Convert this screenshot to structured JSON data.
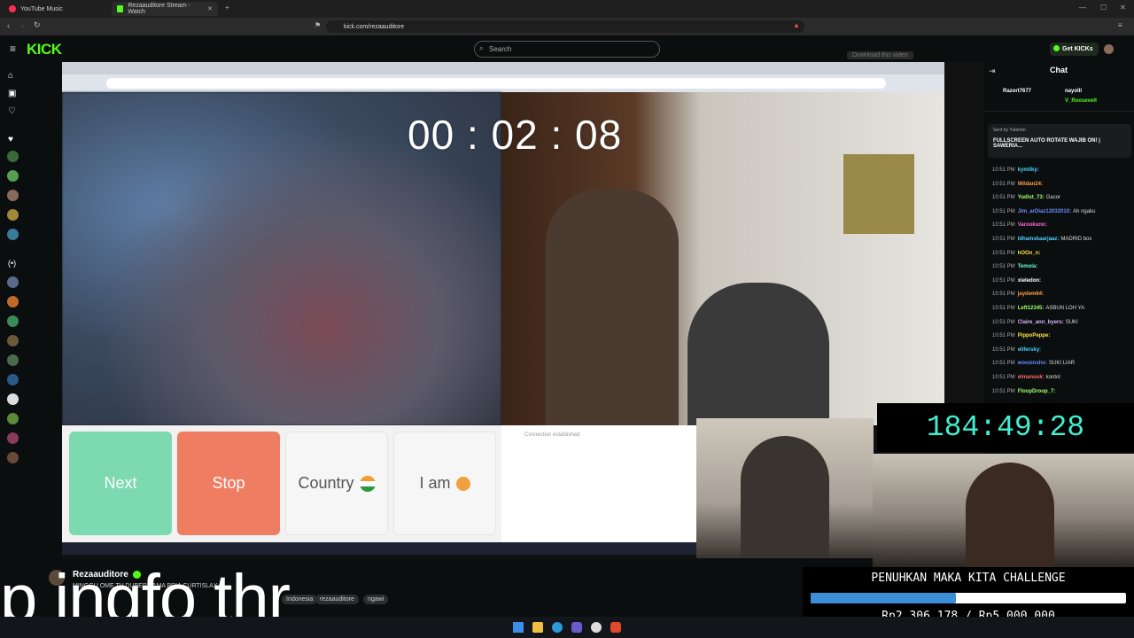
{
  "browser": {
    "tabs": [
      {
        "label": "YouTube Music",
        "icon_color": "#ff2d55",
        "active": false
      },
      {
        "label": "Rezaauditore Stream - Watch",
        "icon_color": "#53fc18",
        "active": true
      }
    ],
    "url": "kick.com/rezaauditore"
  },
  "kick": {
    "logo": "KICK",
    "search_placeholder": "Search",
    "get_kicks": "Get KICKs",
    "download_hint": "Download this video"
  },
  "omegle": {
    "timer": "00 : 02 : 08",
    "buttons": {
      "next": "Next",
      "stop": "Stop",
      "country": "Country",
      "iam": "I am"
    },
    "chat_status": "Connection established"
  },
  "overlay": {
    "counter": "184:49:28",
    "caption": "p ingfo thr"
  },
  "challenge": {
    "title": "PENUHKAN MAKA KITA CHALLENGE",
    "amount": "Rp2.306.178 / Rp5.000.000",
    "progress": 0.461
  },
  "streamer": {
    "name": "Rezaauditore",
    "stream_title": "MINGGU OME TV DUBERMAMA PRIA CURTISLAX",
    "tags": [
      "Indonesia",
      "rezaauditore",
      "ngawi"
    ]
  },
  "chat": {
    "header": "Chat",
    "top_users": [
      "Razort7677",
      "nayolll",
      "V_Roosevelt"
    ],
    "pinned": "FULLSCREEN AUTO ROTATE WAJIB ON! | SAWERIA...",
    "pinned_by": "Sent by Yuterion",
    "messages": [
      {
        "time": "10:51 PM",
        "user": "kymilky:",
        "text": "",
        "color": "#4fd1ff"
      },
      {
        "time": "10:51 PM",
        "user": "Wildan24:",
        "text": "",
        "color": "#ff9f4a"
      },
      {
        "time": "10:51 PM",
        "user": "Yudist_73:",
        "text": "Gacor",
        "color": "#a0ff6a"
      },
      {
        "time": "10:51 PM",
        "user": "Jim_arDiaz12032010:",
        "text": "Ah ngaku",
        "color": "#6a8cff"
      },
      {
        "time": "10:51 PM",
        "user": "Varookuno:",
        "text": "",
        "color": "#ff6ad5"
      },
      {
        "time": "10:51 PM",
        "user": "Idhamskaarjaaz:",
        "text": "MADRID bos",
        "color": "#4fd1ff"
      },
      {
        "time": "10:51 PM",
        "user": "hOOn_n:",
        "text": "",
        "color": "#ffe14a"
      },
      {
        "time": "10:51 PM",
        "user": "Temola:",
        "text": "",
        "color": "#6affc8"
      },
      {
        "time": "10:51 PM",
        "user": "xieledon:",
        "text": "",
        "color": "#ffffff"
      },
      {
        "time": "10:51 PM",
        "user": "jaydem64:",
        "text": "",
        "color": "#ff9f4a"
      },
      {
        "time": "10:51 PM",
        "user": "Left12345:",
        "text": "ASBUN LOH YA",
        "color": "#a0ff6a"
      },
      {
        "time": "10:51 PM",
        "user": "Claire_ann_byers:",
        "text": "SUKI",
        "color": "#d9b3ff"
      },
      {
        "time": "10:51 PM",
        "user": "PippoPeppe:",
        "text": "",
        "color": "#ffe14a"
      },
      {
        "time": "10:51 PM",
        "user": "elifersky:",
        "text": "",
        "color": "#4fd1ff"
      },
      {
        "time": "10:51 PM",
        "user": "woosinsho:",
        "text": "SUKI LIAR",
        "color": "#6a8cff"
      },
      {
        "time": "10:51 PM",
        "user": "elmanuuk:",
        "text": "kontol",
        "color": "#ff6a6a"
      },
      {
        "time": "10:51 PM",
        "user": "FloopDroop_7:",
        "text": "",
        "color": "#a0ff6a"
      }
    ]
  },
  "colors": {
    "kick_green": "#53fc18",
    "next_btn": "#7dd9b0",
    "stop_btn": "#ef7d62",
    "counter_text": "#3ef0d0",
    "progress_fill": "#3a8fd8"
  }
}
